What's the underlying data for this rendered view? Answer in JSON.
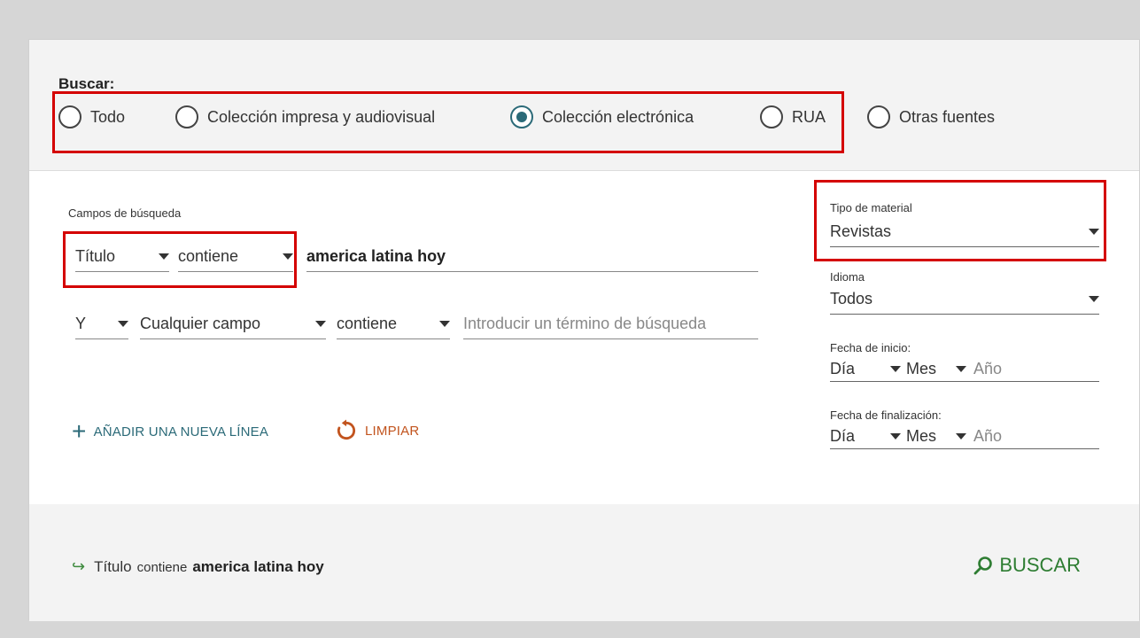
{
  "search_scope": {
    "label": "Buscar:",
    "options": [
      {
        "label": "Todo",
        "checked": false
      },
      {
        "label": "Colección impresa y audiovisual",
        "checked": false
      },
      {
        "label": "Colección electrónica",
        "checked": true
      },
      {
        "label": "RUA",
        "checked": false
      },
      {
        "label": "Otras fuentes",
        "checked": false
      }
    ]
  },
  "fields": {
    "label": "Campos de búsqueda",
    "row1": {
      "field": "Título",
      "operator": "contiene",
      "value": "america latina hoy"
    },
    "row2": {
      "boolean": "Y",
      "field": "Cualquier campo",
      "operator": "contiene",
      "placeholder": "Introducir un término de búsqueda"
    }
  },
  "actions": {
    "add_line": "AÑADIR UNA NUEVA LÍNEA",
    "clear": "LIMPIAR"
  },
  "filters": {
    "material_label": "Tipo de material",
    "material_value": "Revistas",
    "language_label": "Idioma",
    "language_value": "Todos",
    "start_label": "Fecha de inicio:",
    "end_label": "Fecha de finalización:",
    "day": "Día",
    "month": "Mes",
    "year": "Año"
  },
  "summary": {
    "field": "Título",
    "operator": "contiene",
    "value": "america latina hoy"
  },
  "search_button": "BUSCAR",
  "colors": {
    "accent": "#2b6a78",
    "highlight": "#d40000",
    "search": "#2e7d32",
    "clear": "#c2541e"
  }
}
